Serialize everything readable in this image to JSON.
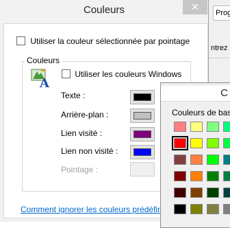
{
  "background_window": {
    "tab_label": "Progr",
    "body_text": "ntrez c"
  },
  "dialog": {
    "title": "Couleurs",
    "close_glyph": "✕",
    "use_selection_label": "Utiliser la couleur sélectionnée par pointage",
    "group_title": "Couleurs",
    "use_windows_label": "Utiliser les couleurs Windows",
    "rows": [
      {
        "label": "Texte :",
        "color": "#000000"
      },
      {
        "label": "Arrière-plan :",
        "color": "#c0c0c0"
      },
      {
        "label": "Lien visité :",
        "color": "#800080"
      },
      {
        "label": "Lien non visité :",
        "color": "#0000ff"
      },
      {
        "label": "Pointage :",
        "color": ""
      }
    ],
    "link_text": "Comment ignorer les couleurs prédéfinies"
  },
  "color_picker": {
    "title": "C",
    "base_label": "Couleurs de base",
    "grid": [
      [
        "#ff8080",
        "#ffff80",
        "#80ff80",
        "#00ff80"
      ],
      [
        "#ff0000",
        "#ffff00",
        "#80ff00",
        "#00ff40"
      ],
      [
        "#804040",
        "#ff8040",
        "#00ff00",
        "#008080"
      ],
      [
        "#800000",
        "#ff8000",
        "#008000",
        "#008040"
      ],
      [
        "#400000",
        "#804000",
        "#004000",
        "#004040"
      ],
      [
        "#000000",
        "#808000",
        "#808040",
        "#808080"
      ]
    ],
    "selected": [
      1,
      0
    ]
  }
}
